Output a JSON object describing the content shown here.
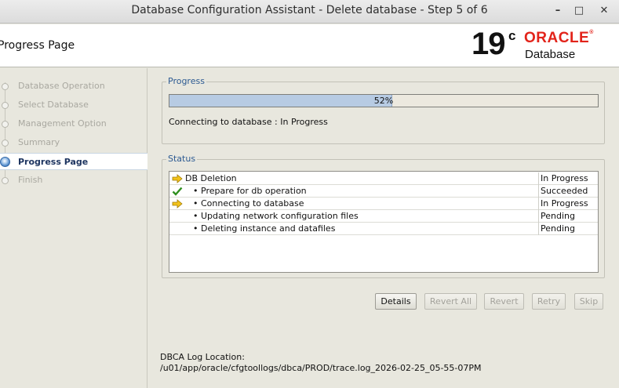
{
  "window": {
    "title": "Database Configuration Assistant - Delete database - Step 5 of 6",
    "controls": {
      "minimize": "–",
      "maximize": "□",
      "close": "✕"
    }
  },
  "header": {
    "page_title": "Progress Page",
    "logo": {
      "version": "19",
      "version_sup": "c",
      "brand": "ORACLE",
      "brand_reg": "®",
      "product": "Database"
    }
  },
  "nav": {
    "items": [
      {
        "label": "Database Operation",
        "state": "done"
      },
      {
        "label": "Select Database",
        "state": "done"
      },
      {
        "label": "Management Option",
        "state": "done"
      },
      {
        "label": "Summary",
        "state": "done"
      },
      {
        "label": "Progress Page",
        "state": "active"
      },
      {
        "label": "Finish",
        "state": "pending"
      }
    ]
  },
  "progress": {
    "legend": "Progress",
    "percent_label": "52%",
    "percent_value": 52,
    "message": "Connecting to database : In Progress"
  },
  "status": {
    "legend": "Status",
    "rows": [
      {
        "icon": "arrow-icon",
        "step": "DB Deletion",
        "bullet": "",
        "status": "In Progress"
      },
      {
        "icon": "checkmark-icon",
        "step": "Prepare for db operation",
        "bullet": "•",
        "status": "Succeeded"
      },
      {
        "icon": "arrow-icon",
        "step": "Connecting to database",
        "bullet": "•",
        "status": "In Progress"
      },
      {
        "icon": "",
        "step": "Updating network configuration files",
        "bullet": "•",
        "status": "Pending"
      },
      {
        "icon": "",
        "step": "Deleting instance and datafiles",
        "bullet": "•",
        "status": "Pending"
      }
    ]
  },
  "buttons": {
    "details": "Details",
    "revert_all": "Revert All",
    "revert": "Revert",
    "retry": "Retry",
    "skip": "Skip"
  },
  "log": {
    "label": "DBCA Log Location:",
    "path": "/u01/app/oracle/cfgtoollogs/dbca/PROD/trace.log_2026-02-25_05-55-07PM"
  },
  "colors": {
    "accent": "#2c5a92",
    "oracle_red": "#e2231a",
    "progress_fill": "#b7cbe3"
  }
}
